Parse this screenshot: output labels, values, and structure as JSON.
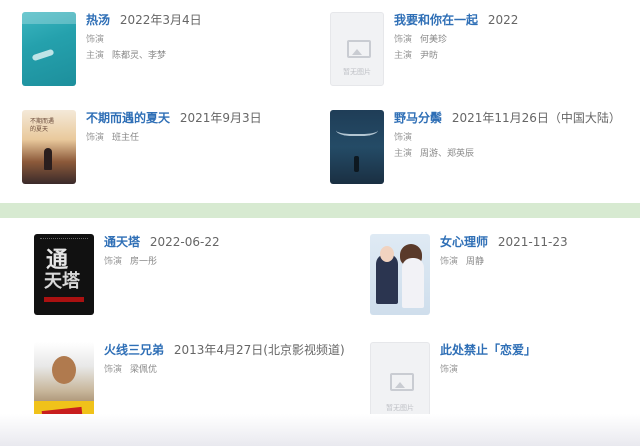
{
  "labels": {
    "role": "饰演",
    "cast": "主演",
    "placeholder": "暂无图片"
  },
  "top_section": {
    "items": [
      {
        "title": "热汤",
        "date": "2022年3月4日",
        "role": "",
        "cast": "陈都灵、李梦",
        "poster": "pool-swimmer"
      },
      {
        "title": "我要和你在一起",
        "date": "2022",
        "role": "何美珍",
        "cast": "尹昉",
        "poster": "placeholder"
      },
      {
        "title": "不期而遇的夏天",
        "date": "2021年9月3日",
        "role": "班主任",
        "cast": "",
        "poster": "summer-silhouette"
      },
      {
        "title": "野马分鬃",
        "date": "2021年11月26日（中国大陆）",
        "role": "",
        "cast": "周游、郑英辰",
        "poster": "night-blue-figure"
      }
    ]
  },
  "bottom_section": {
    "items": [
      {
        "title": "通天塔",
        "date": "2022-06-22",
        "role": "房一彤",
        "poster": "black-calligraphy"
      },
      {
        "title": "女心理师",
        "date": "2021-11-23",
        "role": "周静",
        "poster": "couple-portrait"
      },
      {
        "title": "火线三兄弟",
        "date": "2013年4月27日(北京影视频道)",
        "role": "梁佩优",
        "poster": "action-men"
      },
      {
        "title": "此处禁止「恋爱」",
        "date": "",
        "role": "",
        "poster": "placeholder"
      }
    ]
  },
  "colors": {
    "title_blue": "#2f6fb6",
    "divider_green": "#d7ead1"
  }
}
